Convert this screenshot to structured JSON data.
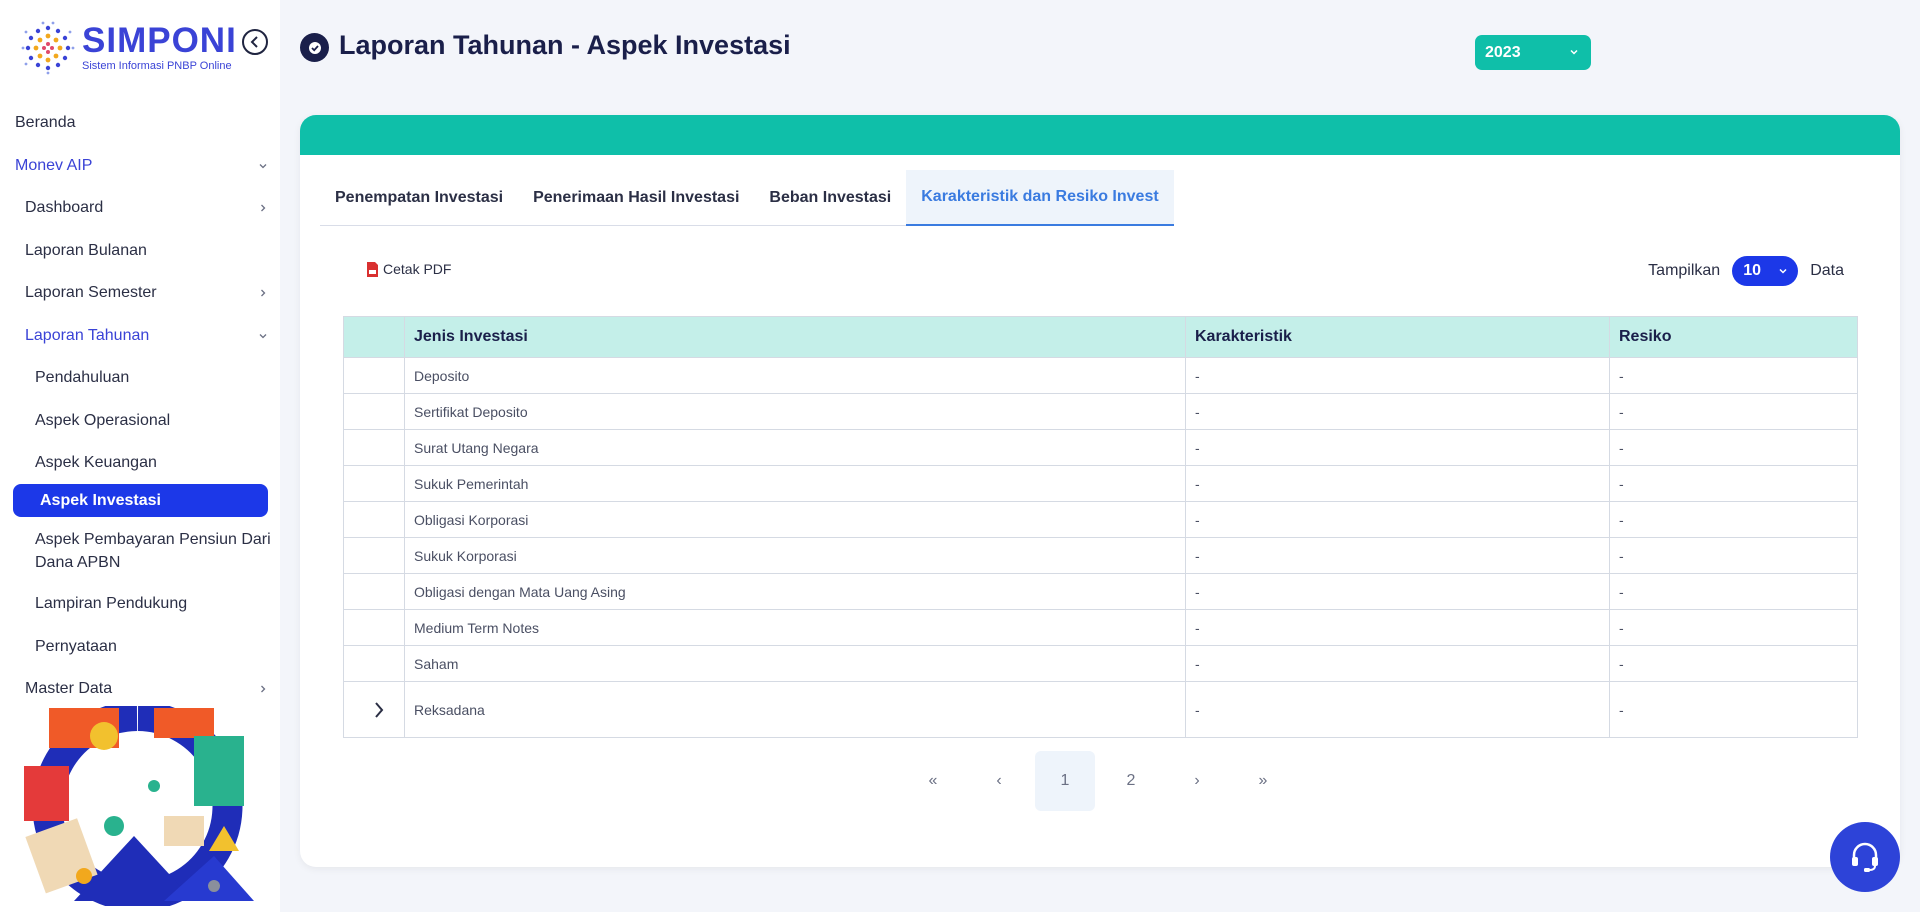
{
  "brand": {
    "title": "SIMPONI",
    "subtitle": "Sistem Informasi PNBP Online",
    "primary_color": "#3a43d6",
    "teal_color": "#0fbfa9",
    "active_color": "#1c38e8"
  },
  "sidebar": {
    "items": {
      "beranda": "Beranda",
      "monev": "Monev AIP",
      "dashboard": "Dashboard",
      "laporan_bulanan": "Laporan Bulanan",
      "laporan_semester": "Laporan Semester",
      "laporan_tahunan": "Laporan Tahunan",
      "pendahuluan": "Pendahuluan",
      "aspek_operasional": "Aspek Operasional",
      "aspek_keuangan": "Aspek Keuangan",
      "aspek_investasi": "Aspek Investasi",
      "aspek_pembayaran_1": "Aspek Pembayaran Pensiun Dari",
      "aspek_pembayaran_2": "Dana APBN",
      "lampiran": "Lampiran Pendukung",
      "pernyataan": "Pernyataan",
      "master_data": "Master Data"
    }
  },
  "header": {
    "title": "Laporan Tahunan - Aspek Investasi",
    "year": "2023"
  },
  "tabs": {
    "t1": "Penempatan Investasi",
    "t2": "Penerimaan Hasil Investasi",
    "t3": "Beban Investasi",
    "t4": "Karakteristik dan Resiko Invest"
  },
  "toolbar": {
    "pdf_label": "Cetak PDF",
    "show_label": "Tampilkan",
    "show_value": "10",
    "data_label": "Data"
  },
  "table": {
    "headers": {
      "jenis": "Jenis Investasi",
      "karakteristik": "Karakteristik",
      "resiko": "Resiko"
    },
    "rows": [
      {
        "jenis": "Deposito",
        "karakteristik": "-",
        "resiko": "-"
      },
      {
        "jenis": "Sertifikat Deposito",
        "karakteristik": "-",
        "resiko": "-"
      },
      {
        "jenis": "Surat Utang Negara",
        "karakteristik": "-",
        "resiko": "-"
      },
      {
        "jenis": "Sukuk Pemerintah",
        "karakteristik": "-",
        "resiko": "-"
      },
      {
        "jenis": "Obligasi Korporasi",
        "karakteristik": "-",
        "resiko": "-"
      },
      {
        "jenis": "Sukuk Korporasi",
        "karakteristik": "-",
        "resiko": "-"
      },
      {
        "jenis": "Obligasi dengan Mata Uang Asing",
        "karakteristik": "-",
        "resiko": "-"
      },
      {
        "jenis": "Medium Term Notes",
        "karakteristik": "-",
        "resiko": "-"
      },
      {
        "jenis": "Saham",
        "karakteristik": "-",
        "resiko": "-"
      },
      {
        "jenis": "Reksadana",
        "karakteristik": "-",
        "resiko": "-"
      }
    ]
  },
  "pagination": {
    "first": "«",
    "prev": "‹",
    "page1": "1",
    "page2": "2",
    "next": "›",
    "last": "»"
  }
}
